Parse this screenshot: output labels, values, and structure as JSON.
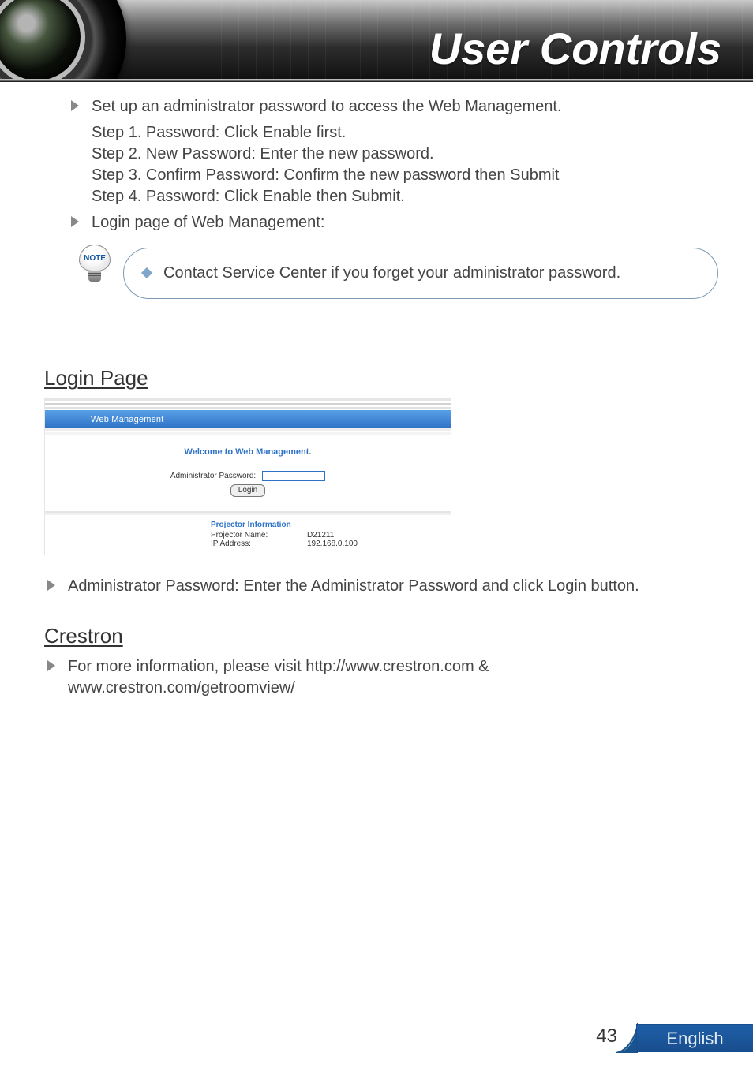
{
  "banner": {
    "title": "User Controls"
  },
  "setup": {
    "intro": "Set up an administrator password to access the Web Management.",
    "step1": "Step 1. Password: Click Enable first.",
    "step2": "Step 2. New Password: Enter the new password.",
    "step3": "Step 3. Confirm Password: Confirm the new password then Submit",
    "step4": "Step 4. Password: Click Enable then Submit.",
    "login_intro": "Login page of Web Management:"
  },
  "note": {
    "icon_label": "NOTE",
    "text": "Contact Service Center if you forget your administrator password."
  },
  "login": {
    "heading": "Login Page",
    "tab_label": "Web Management",
    "welcome": "Welcome to Web Management.",
    "password_label": "Administrator Password:",
    "login_button": "Login",
    "info_title": "Projector Information",
    "projector_name_label": "Projector Name:",
    "projector_name_value": "D21211",
    "ip_label": "IP Address:",
    "ip_value": "192.168.0.100",
    "instruction": "Administrator Password: Enter the Administrator Password and click Login button."
  },
  "crestron": {
    "heading": "Crestron",
    "text": "For more information, please visit http://www.crestron.com & www.crestron.com/getroomview/"
  },
  "footer": {
    "page": "43",
    "language": "English"
  }
}
